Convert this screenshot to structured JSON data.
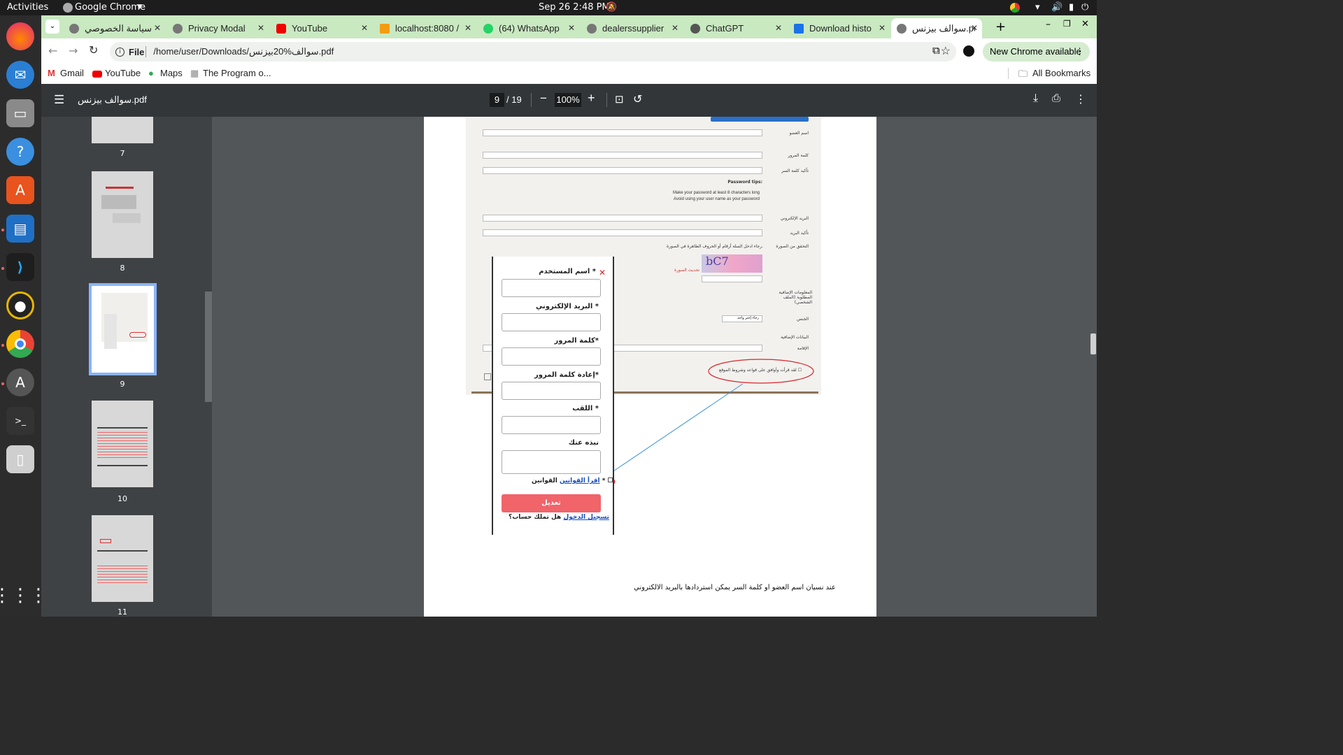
{
  "system": {
    "activities": "Activities",
    "app_name": "Google Chrome",
    "datetime": "Sep 26  2:48 PM"
  },
  "tabs": [
    {
      "label": "سياسة الخصوصي",
      "favicon": "globe-icon"
    },
    {
      "label": "Privacy Modal",
      "favicon": "globe-icon"
    },
    {
      "label": "YouTube",
      "favicon": "youtube-icon"
    },
    {
      "label": "localhost:8080 /",
      "favicon": "phpmyadmin-icon"
    },
    {
      "label": "(64) WhatsApp",
      "favicon": "whatsapp-icon"
    },
    {
      "label": "dealerssupplier",
      "favicon": "globe-icon"
    },
    {
      "label": "ChatGPT",
      "favicon": "chatgpt-icon"
    },
    {
      "label": "Download histo",
      "favicon": "download-icon"
    },
    {
      "label": "سوالف بيزنس.pdf",
      "favicon": "globe-icon"
    }
  ],
  "omnibox": {
    "scheme": "File",
    "url": "/home/user/Downloads/سوالف%20بيزنس.pdf"
  },
  "new_chrome": "New Chrome available",
  "bookmarks": {
    "items": [
      "Gmail",
      "YouTube",
      "Maps",
      "The Program o..."
    ],
    "all": "All Bookmarks"
  },
  "pdf": {
    "title": "سوالف بيزنس.pdf",
    "page_current": "9",
    "page_total": "/ 19",
    "zoom": "100%"
  },
  "thumbnails": [
    "7",
    "8",
    "9",
    "10",
    "11"
  ],
  "background_form": {
    "labels": [
      "اسم العضو",
      "كلمة المرور",
      "تأكيد كلمة السر",
      "البريد الإلكتروني",
      "تأكيد البريد",
      "التحقق من الصورة",
      "المعلومات الإضافية المطلوبة (الملف الشخصي)",
      "الجنس",
      "البيانات الإضافية",
      "الإقامة"
    ],
    "password_tips_title": "Password tips:",
    "password_tips": [
      "Make your password at least 8 characters long",
      "Avoid using your user name as your password"
    ],
    "captcha_hint": "رجاء ادخل السلة أرقام أو الحروف الظاهرة في الصورة.",
    "refresh_image": "تحديث الصورة",
    "captcha_text": "bC7",
    "gender_select": "رجاء إختر واحد",
    "terms_checkbox": "لقد قرأت وأوافق على قواعد وشروط الموقع"
  },
  "modal_form": {
    "username": "اسم المستخدم *",
    "email": "البريد الإلكتروني *",
    "password": "كلمة المرور*",
    "password_confirm": "إعادة كلمة المرور*",
    "nickname": "اللقب *",
    "bio": "نبذه عنك",
    "rules_label": "القوانين *",
    "rules_link": "اقرأ القوانين",
    "submit": "تعديل",
    "have_account": "هل تملك حساب؟",
    "login_link": "تسجيل الدخول"
  },
  "page_text": "عند نسيان اسم العضو او كلمة السر يمكن استردادها بالبريد الالكتروني",
  "colors": {
    "tabbar": "#c9e9c1",
    "submit": "#f0646a",
    "annotation": "#d9262c"
  }
}
